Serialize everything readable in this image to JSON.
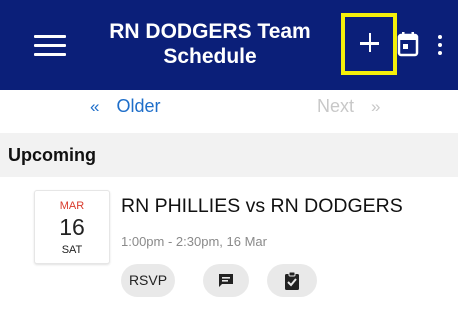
{
  "app_bar": {
    "title_line1": "RN DODGERS Team",
    "title_line2": "Schedule",
    "background_color": "#0b1f79",
    "highlight_color": "#f5ef0a",
    "icons": [
      "menu-icon",
      "plus-icon",
      "calendar-icon",
      "more-vert-icon"
    ]
  },
  "pager": {
    "older_chevron": "«",
    "older_label": "Older",
    "next_label": "Next",
    "next_chevron": "»",
    "next_enabled": false
  },
  "section": {
    "title": "Upcoming"
  },
  "events": [
    {
      "month": "MAR",
      "day": "16",
      "weekday": "SAT",
      "title": "RN PHILLIES vs RN DODGERS",
      "time": "1:00pm - 2:30pm, 16 Mar",
      "actions": {
        "rsvp_label": "RSVP",
        "message_icon": "message-icon",
        "checklist_icon": "clipboard-check-icon"
      }
    }
  ]
}
